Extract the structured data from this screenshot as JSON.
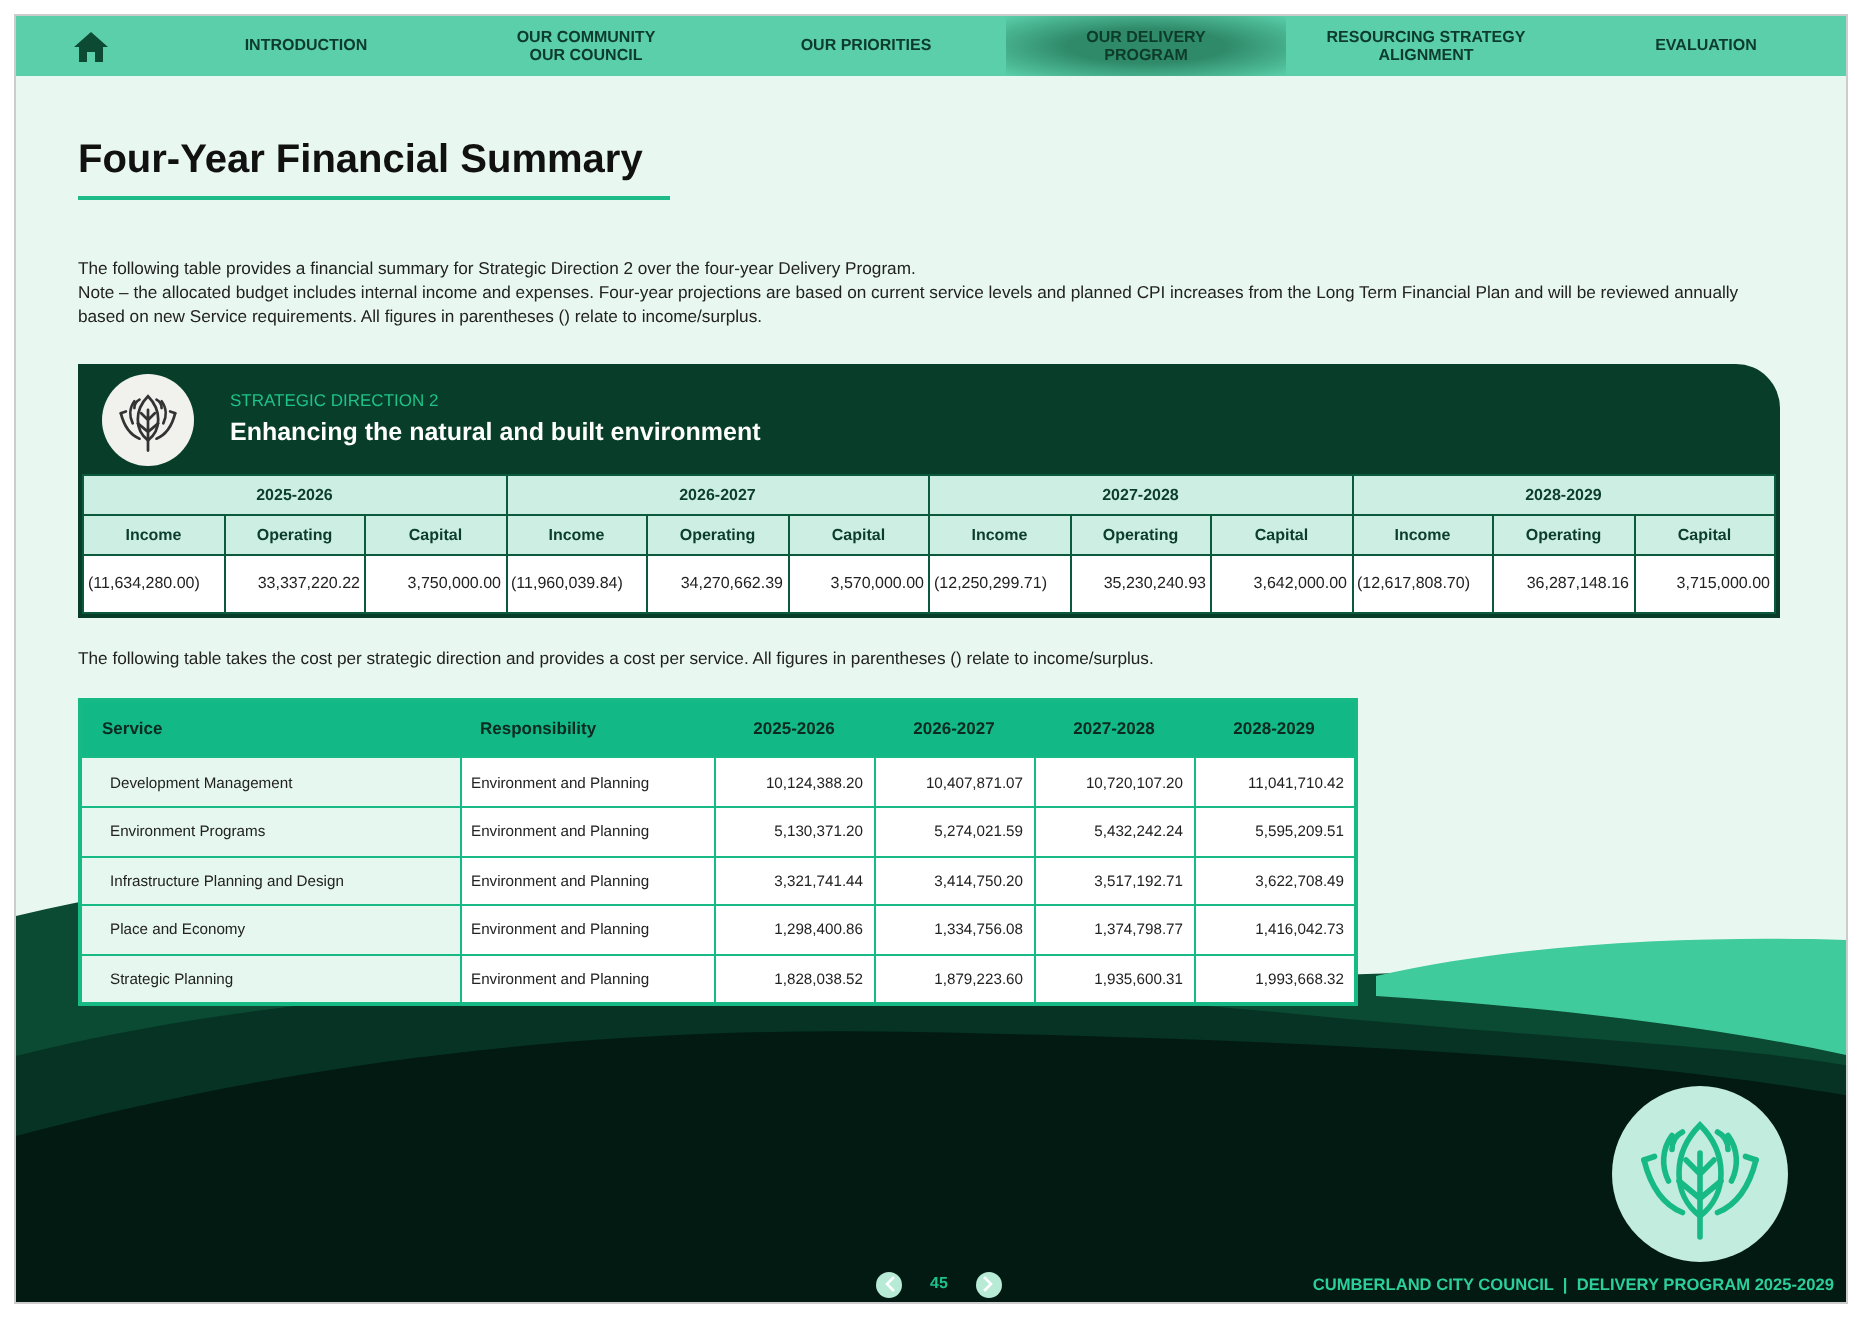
{
  "nav": {
    "items": [
      {
        "label": "INTRODUCTION",
        "selected": false
      },
      {
        "label": "OUR COMMUNITY\nOUR COUNCIL",
        "selected": false
      },
      {
        "label": "OUR PRIORITIES",
        "selected": false
      },
      {
        "label": "OUR DELIVERY\nPROGRAM",
        "selected": true
      },
      {
        "label": "RESOURCING STRATEGY\nALIGNMENT",
        "selected": false
      },
      {
        "label": "EVALUATION",
        "selected": false
      }
    ]
  },
  "title": "Four-Year Financial Summary",
  "intro": [
    "The following table provides a financial summary for Strategic Direction 2 over the four-year Delivery Program.",
    "Note – the allocated budget includes internal income and expenses. Four-year projections are based on current service levels and planned CPI increases from the Long Term Financial Plan and will be reviewed annually based on new Service requirements. All figures in parentheses () relate to income/surplus."
  ],
  "direction": {
    "label": "STRATEGIC DIRECTION 2",
    "title": "Enhancing the natural and built environment",
    "years": [
      {
        "year": "2025-2026",
        "columns": [
          "Income",
          "Operating",
          "Capital"
        ],
        "values": [
          "(11,634,280.00)",
          "33,337,220.22",
          "3,750,000.00"
        ]
      },
      {
        "year": "2026-2027",
        "columns": [
          "Income",
          "Operating",
          "Capital"
        ],
        "values": [
          "(11,960,039.84)",
          "34,270,662.39",
          "3,570,000.00"
        ]
      },
      {
        "year": "2027-2028",
        "columns": [
          "Income",
          "Operating",
          "Capital"
        ],
        "values": [
          "(12,250,299.71)",
          "35,230,240.93",
          "3,642,000.00"
        ]
      },
      {
        "year": "2028-2029",
        "columns": [
          "Income",
          "Operating",
          "Capital"
        ],
        "values": [
          "(12,617,808.70)",
          "36,287,148.16",
          "3,715,000.00"
        ]
      }
    ]
  },
  "services_note": "The following table takes the cost per strategic direction and provides a cost per service. All figures in parentheses () relate to income/surplus.",
  "services": {
    "columns": [
      "Service",
      "Responsibility",
      "2025-2026",
      "2026-2027",
      "2027-2028",
      "2028-2029"
    ],
    "rows": [
      [
        "Development Management",
        "Environment and Planning",
        "10,124,388.20",
        "10,407,871.07",
        "10,720,107.20",
        "11,041,710.42"
      ],
      [
        "Environment Programs",
        "Environment and Planning",
        "5,130,371.20",
        "5,274,021.59",
        "5,432,242.24",
        "5,595,209.51"
      ],
      [
        "Infrastructure Planning and Design",
        "Environment and Planning",
        "3,321,741.44",
        "3,414,750.20",
        "3,517,192.71",
        "3,622,708.49"
      ],
      [
        "Place and Economy",
        "Environment and Planning",
        "1,298,400.86",
        "1,334,756.08",
        "1,374,798.77",
        "1,416,042.73"
      ],
      [
        "Strategic Planning",
        "Environment and Planning",
        "1,828,038.52",
        "1,879,223.60",
        "1,935,600.31",
        "1,993,668.32"
      ]
    ]
  },
  "footer": {
    "page": "45",
    "text": "CUMBERLAND CITY COUNCIL  |  DELIVERY PROGRAM 2025-2029"
  }
}
